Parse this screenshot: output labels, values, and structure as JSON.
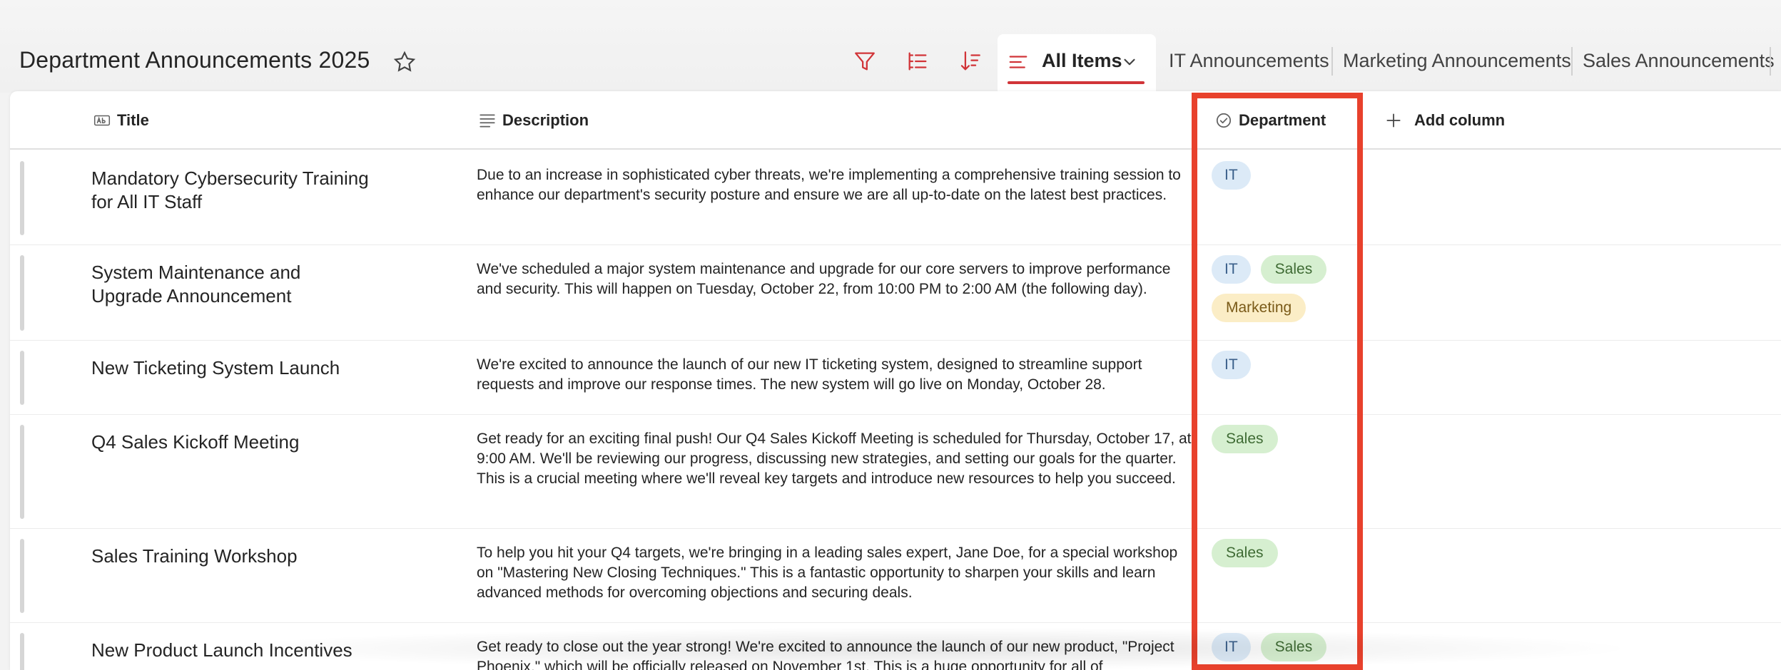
{
  "page": {
    "title": "Department Announcements 2025"
  },
  "views": {
    "active": "All Items",
    "tabs": [
      "IT Announcements",
      "Marketing Announcements",
      "Sales Announcements"
    ]
  },
  "columns": {
    "title": "Title",
    "description": "Description",
    "department": "Department",
    "add_column": "Add column"
  },
  "rows": [
    {
      "title": "Mandatory Cybersecurity Training for All IT Staff",
      "description": "Due to an increase in sophisticated cyber threats, we're implementing a comprehensive training session to enhance our department's security posture and ensure we are all up-to-date on the latest best practices.",
      "tags": [
        "IT"
      ]
    },
    {
      "title": "System Maintenance and Upgrade Announcement",
      "description": "We've scheduled a major system maintenance and upgrade for our core servers to improve performance and security. This will happen on Tuesday, October 22, from 10:00 PM to 2:00 AM (the following day).",
      "tags": [
        "IT",
        "Sales",
        "Marketing"
      ]
    },
    {
      "title": "New Ticketing System Launch",
      "description": "We're excited to announce the launch of our new IT ticketing system, designed to streamline support requests and improve our response times. The new system will go live on Monday, October 28.",
      "tags": [
        "IT"
      ]
    },
    {
      "title": "Q4 Sales Kickoff Meeting",
      "description": "Get ready for an exciting final push! Our Q4 Sales Kickoff Meeting is scheduled for Thursday, October 17, at 9:00 AM. We'll be reviewing our progress, discussing new strategies, and setting our goals for the quarter. This is a crucial meeting where we'll reveal key targets and introduce new resources to help you succeed.",
      "tags": [
        "Sales"
      ]
    },
    {
      "title": "Sales Training Workshop",
      "description": "To help you hit your Q4 targets, we're bringing in a leading sales expert, Jane Doe, for a special workshop on \"Mastering New Closing Techniques.\" This is a fantastic opportunity to sharpen your skills and learn advanced methods for overcoming objections and securing deals.",
      "tags": [
        "Sales"
      ]
    },
    {
      "title": "New Product Launch Incentives",
      "description": "Get ready to close out the year strong! We're excited to announce the launch of our new product, \"Project Phoenix,\" which will be officially released on November 1st. This is a huge opportunity for all of",
      "tags": [
        "IT",
        "Sales"
      ]
    }
  ],
  "colors": {
    "accent": "#d13438",
    "highlight": "#e8412c",
    "tag_it": "#dceaf7",
    "tag_sales": "#d6efd0",
    "tag_marketing": "#fbedc6"
  }
}
